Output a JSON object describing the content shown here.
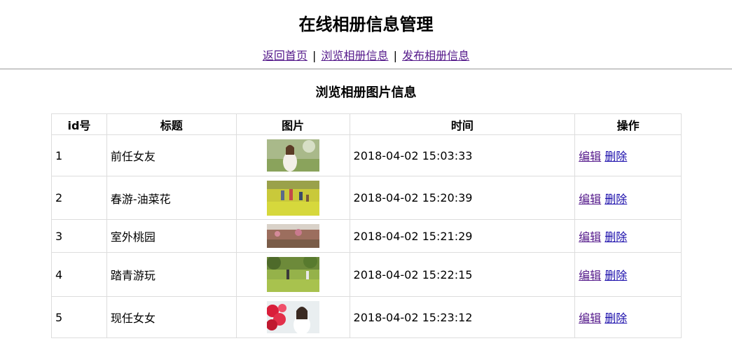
{
  "header": {
    "title": "在线相册信息管理"
  },
  "nav": {
    "items": [
      {
        "label": "返回首页"
      },
      {
        "label": "浏览相册信息"
      },
      {
        "label": "发布相册信息"
      }
    ],
    "separator": "|"
  },
  "section_title": "浏览相册图片信息",
  "table": {
    "columns": [
      "id号",
      "标题",
      "图片",
      "时间",
      "操作"
    ],
    "rows": [
      {
        "id": "1",
        "title": "前任女友",
        "time": "2018-04-02 15:03:33",
        "edit": "编辑",
        "delete": "删除"
      },
      {
        "id": "2",
        "title": "春游-油菜花",
        "time": "2018-04-02 15:20:39",
        "edit": "编辑",
        "delete": "删除"
      },
      {
        "id": "3",
        "title": "室外桃园",
        "time": "2018-04-02 15:21:29",
        "edit": "编辑",
        "delete": "删除"
      },
      {
        "id": "4",
        "title": "踏青游玩",
        "time": "2018-04-02 15:22:15",
        "edit": "编辑",
        "delete": "删除"
      },
      {
        "id": "5",
        "title": "现任女女",
        "time": "2018-04-02 15:23:12",
        "edit": "编辑",
        "delete": "删除"
      }
    ]
  },
  "colors": {
    "link": "#1a0dab",
    "visited": "#551a8b",
    "border": "#dddddd",
    "divider": "#999999"
  }
}
